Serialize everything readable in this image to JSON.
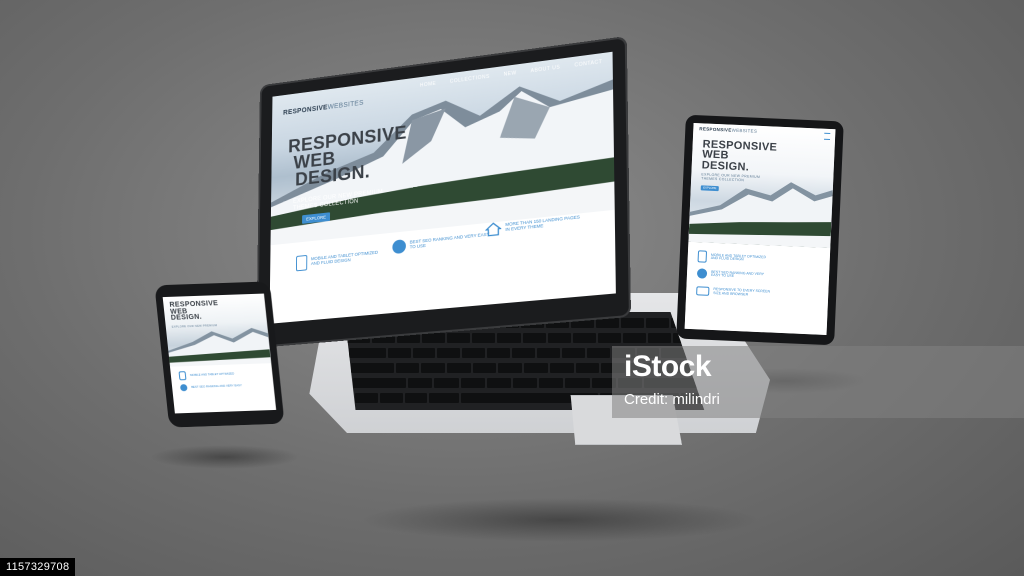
{
  "laptop": {
    "brand_bold": "RESPONSIVE",
    "brand_light": "WEBSITES",
    "nav": [
      "HOME",
      "COLLECTIONS",
      "NEW",
      "ABOUT US",
      "CONTACT"
    ],
    "headline": [
      "RESPONSIVE",
      "WEB",
      "DESIGN."
    ],
    "subtitle": [
      "EXPLORE OUR NEW PREMIUM",
      "THEMES COLLECTION"
    ],
    "button": "EXPLORE",
    "features": [
      {
        "icon": "tablet-icon",
        "text": [
          "MOBILE AND TABLET OPTIMIZED",
          "AND FLUID DESIGN"
        ]
      },
      {
        "icon": "globe-icon",
        "text": [
          "BEST SEO RANKING AND VERY EASY",
          "TO USE"
        ]
      },
      {
        "icon": "house-icon",
        "text": [
          "MORE THAN 150 LANDING PAGES",
          "IN EVERY THEME"
        ]
      }
    ]
  },
  "tablet": {
    "brand_bold": "RESPONSIVE",
    "brand_light": "WEBSITES",
    "headline": [
      "RESPONSIVE",
      "WEB",
      "DESIGN."
    ],
    "subtitle": [
      "EXPLORE OUR NEW PREMIUM",
      "THEMES COLLECTION"
    ],
    "button": "EXPLORE",
    "features": [
      {
        "icon": "tablet-icon",
        "text": [
          "MOBILE AND TABLET OPTIMIZED",
          "AND FLUID DESIGN"
        ]
      },
      {
        "icon": "globe-icon",
        "text": [
          "BEST SEO RANKING AND VERY",
          "EASY TO USE"
        ]
      },
      {
        "icon": "monitor-icon",
        "text": [
          "RESPONSIVE TO EVERY SCREEN",
          "SIZE AND BROWSER"
        ]
      }
    ]
  },
  "phone": {
    "headline": [
      "RESPONSIVE",
      "WEB",
      "DESIGN."
    ],
    "subtitle": "EXPLORE OUR NEW PREMIUM",
    "features": [
      {
        "icon": "tablet-icon",
        "text": "MOBILE AND TABLET OPTIMIZED"
      },
      {
        "icon": "globe-icon",
        "text": "BEST SEO RANKING AND VERY EASY"
      }
    ]
  },
  "watermark": {
    "logo": "iStock",
    "credit": "Credit: milindri"
  },
  "stock_id": "1157329708",
  "colors": {
    "accent": "#3e8ed0",
    "background": "#7a7a7a",
    "device_body": "#1b1c1e",
    "headline": "#3b4148"
  }
}
